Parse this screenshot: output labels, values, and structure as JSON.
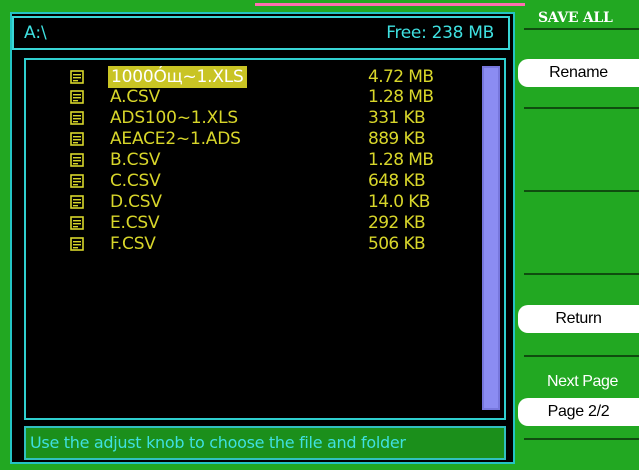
{
  "header": {
    "path": "A:\\",
    "free_space": "Free: 238 MB"
  },
  "files": [
    {
      "name": "1000Óщ~1.XLS",
      "size": "4.72 MB",
      "selected": true
    },
    {
      "name": "A.CSV",
      "size": "1.28 MB",
      "selected": false
    },
    {
      "name": "ADS100~1.XLS",
      "size": "331 KB",
      "selected": false
    },
    {
      "name": "AEACE2~1.ADS",
      "size": "889 KB",
      "selected": false
    },
    {
      "name": "B.CSV",
      "size": "1.28 MB",
      "selected": false
    },
    {
      "name": "C.CSV",
      "size": "648 KB",
      "selected": false
    },
    {
      "name": "D.CSV",
      "size": "14.0 KB",
      "selected": false
    },
    {
      "name": "E.CSV",
      "size": "292 KB",
      "selected": false
    },
    {
      "name": "F.CSV",
      "size": "506 KB",
      "selected": false
    }
  ],
  "file_icon": "document-icon",
  "status": "Use the adjust knob to choose the file and folder",
  "menu": {
    "title": "SAVE ALL",
    "rename": "Rename",
    "return": "Return",
    "next_page": "Next Page",
    "page": "Page 2/2"
  },
  "colors": {
    "background": "#22a822",
    "cyan": "#3fe0e0",
    "file_text": "#d8d62a",
    "selection": "#c9c424",
    "scrollbar": "#8b8cf2"
  }
}
